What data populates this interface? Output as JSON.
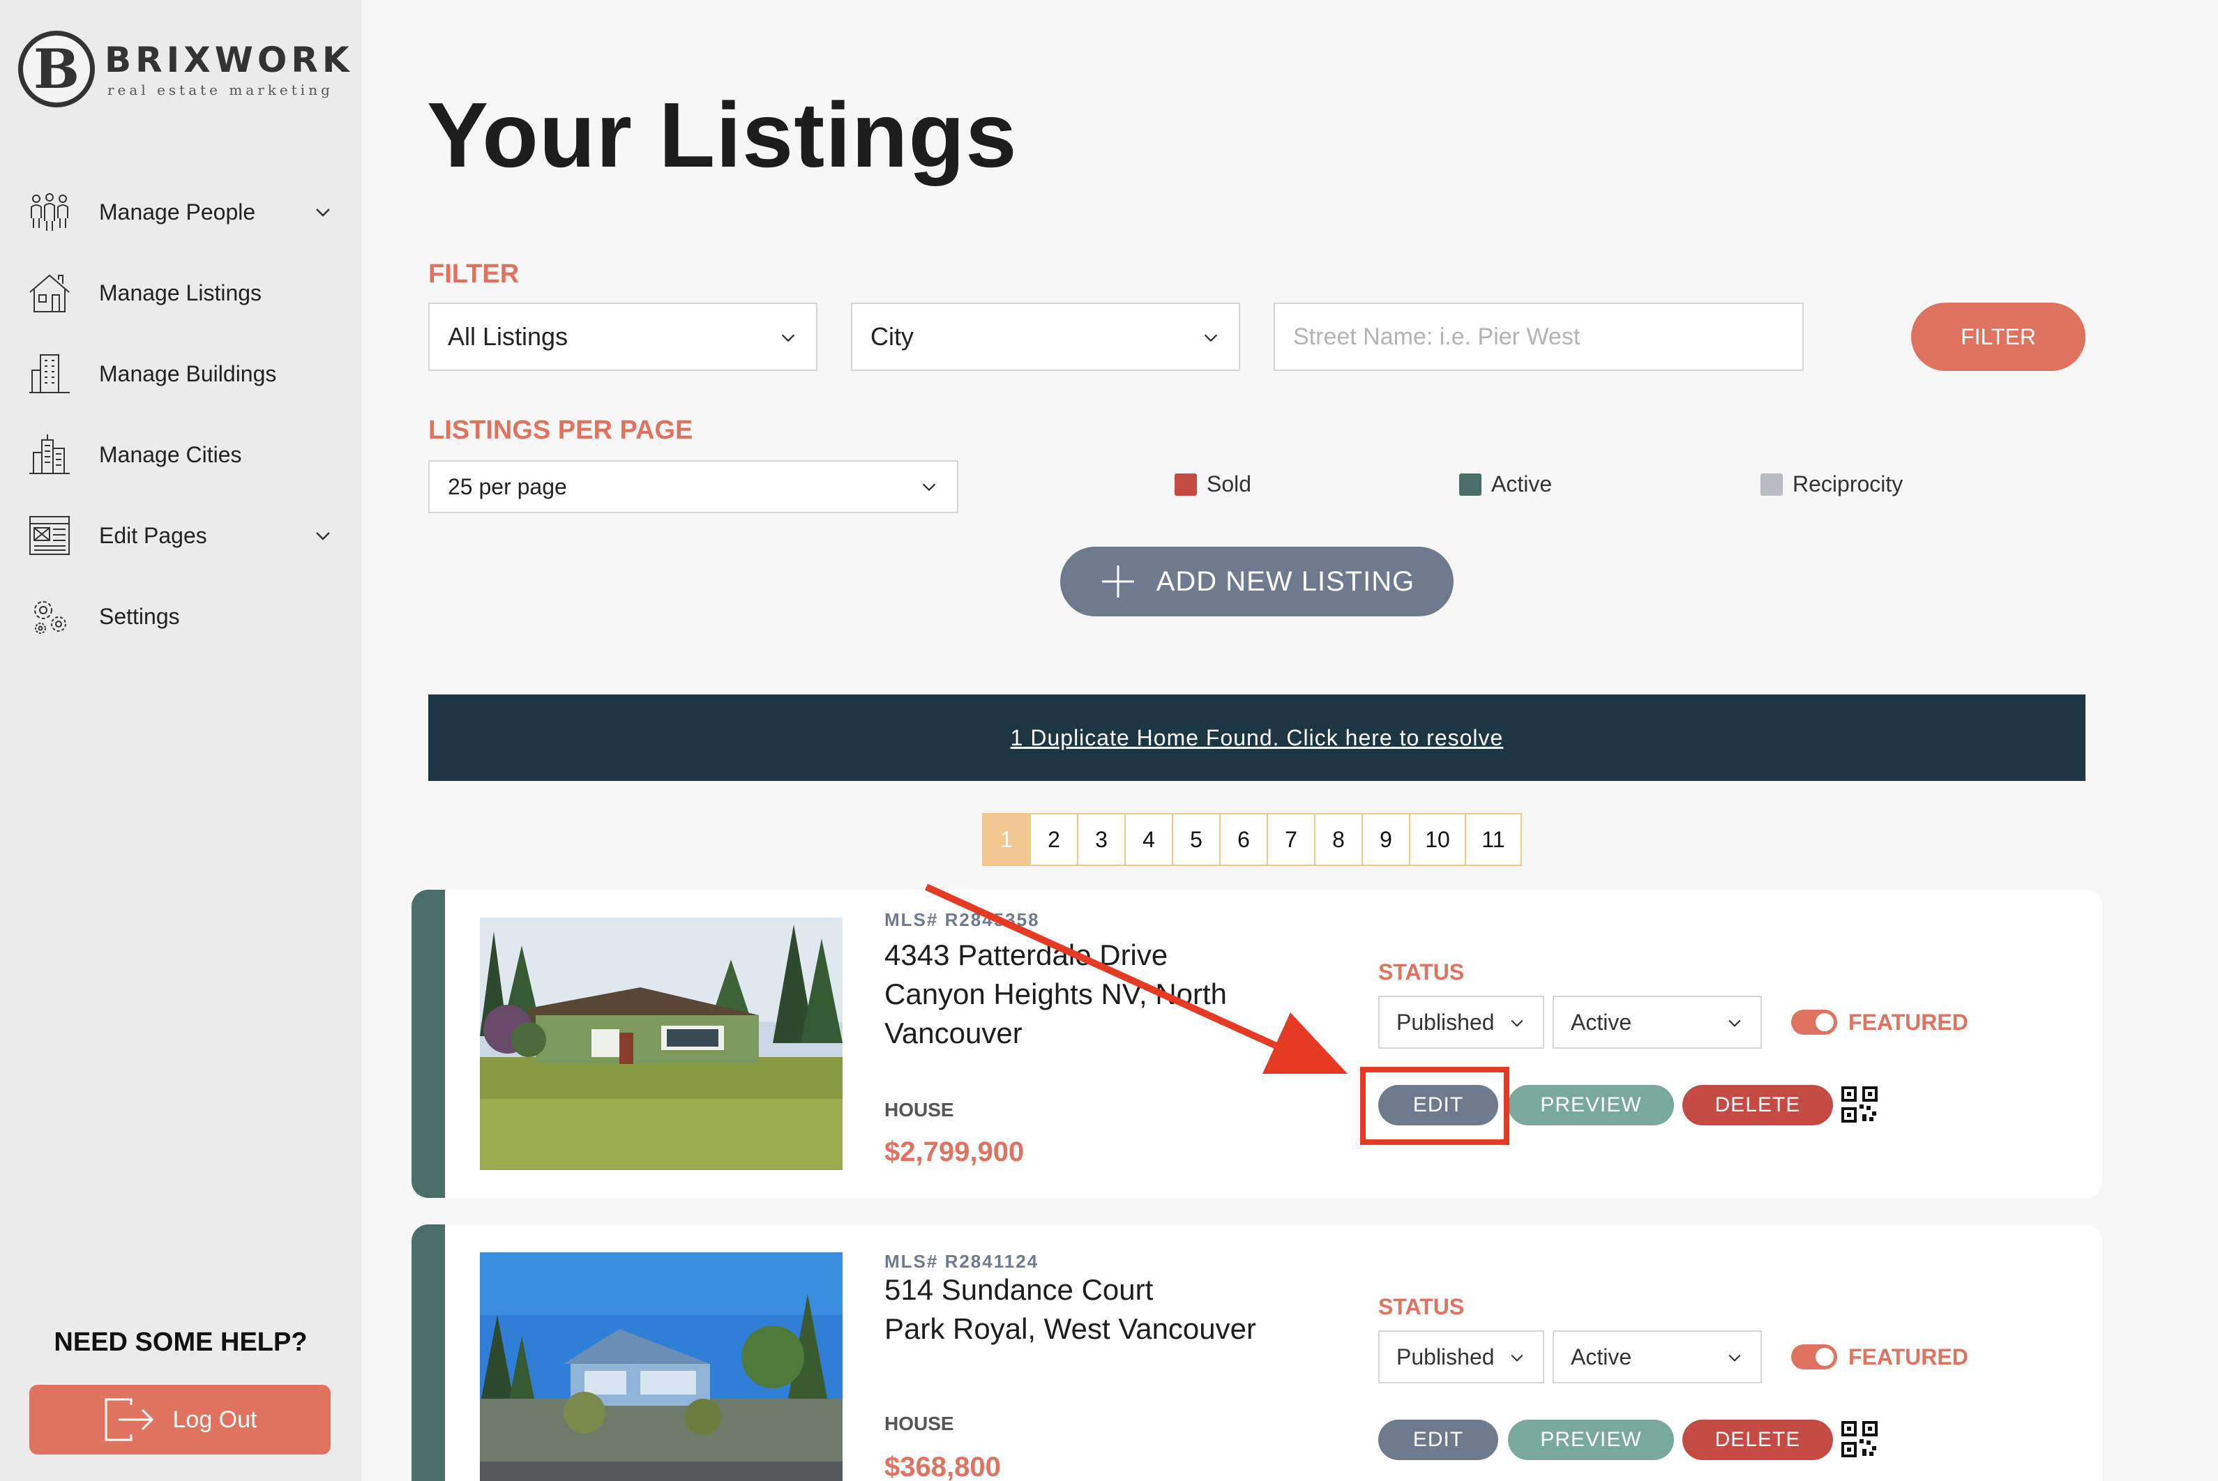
{
  "brand": {
    "name": "BRIXWORK",
    "tagline": "real estate marketing",
    "logo_letter": "B"
  },
  "sidebar": {
    "items": [
      {
        "label": "Manage People",
        "icon": "people-icon",
        "has_dropdown": true
      },
      {
        "label": "Manage Listings",
        "icon": "house-icon",
        "has_dropdown": false
      },
      {
        "label": "Manage Buildings",
        "icon": "building-icon",
        "has_dropdown": false
      },
      {
        "label": "Manage Cities",
        "icon": "city-icon",
        "has_dropdown": false
      },
      {
        "label": "Edit Pages",
        "icon": "page-icon",
        "has_dropdown": true
      },
      {
        "label": "Settings",
        "icon": "gears-icon",
        "has_dropdown": false
      }
    ],
    "help_title": "NEED SOME HELP?",
    "logout_label": "Log Out"
  },
  "main": {
    "title": "Your Listings",
    "filter": {
      "label": "FILTER",
      "listing_type": "All Listings",
      "city": "City",
      "street_placeholder": "Street Name: i.e. Pier West",
      "button": "FILTER"
    },
    "per_page": {
      "label": "LISTINGS PER PAGE",
      "value": "25 per page"
    },
    "legend": [
      {
        "label": "Sold",
        "color": "#c44a44"
      },
      {
        "label": "Active",
        "color": "#4a6f6a"
      },
      {
        "label": "Reciprocity",
        "color": "#b9bcc0"
      }
    ],
    "add_button": "ADD NEW LISTING",
    "duplicate_notice": "1 Duplicate Home Found. Click here to resolve",
    "pages": [
      "1",
      "2",
      "3",
      "4",
      "5",
      "6",
      "7",
      "8",
      "9",
      "10",
      "11"
    ],
    "current_page": "1"
  },
  "listings": [
    {
      "mls": "MLS# R2845358",
      "address_line1": "4343 Patterdale Drive",
      "address_line2": "Canyon Heights NV, North Vancouver",
      "type": "HOUSE",
      "price": "$2,799,900",
      "status_label": "STATUS",
      "publish_status": "Published",
      "listing_status": "Active",
      "featured_label": "FEATURED",
      "featured": true,
      "edit_label": "EDIT",
      "preview_label": "PREVIEW",
      "delete_label": "DELETE"
    },
    {
      "mls": "MLS# R2841124",
      "address_line1": "514 Sundance Court",
      "address_line2": "Park Royal, West Vancouver",
      "type": "HOUSE",
      "price": "$368,800",
      "status_label": "STATUS",
      "publish_status": "Published",
      "listing_status": "Active",
      "featured_label": "FEATURED",
      "featured": true,
      "edit_label": "EDIT",
      "preview_label": "PREVIEW",
      "delete_label": "DELETE"
    }
  ],
  "colors": {
    "accent": "#e07260",
    "banner": "#1d3644",
    "slate": "#6e7b8f",
    "teal": "#79a89d",
    "red": "#c44a44"
  }
}
